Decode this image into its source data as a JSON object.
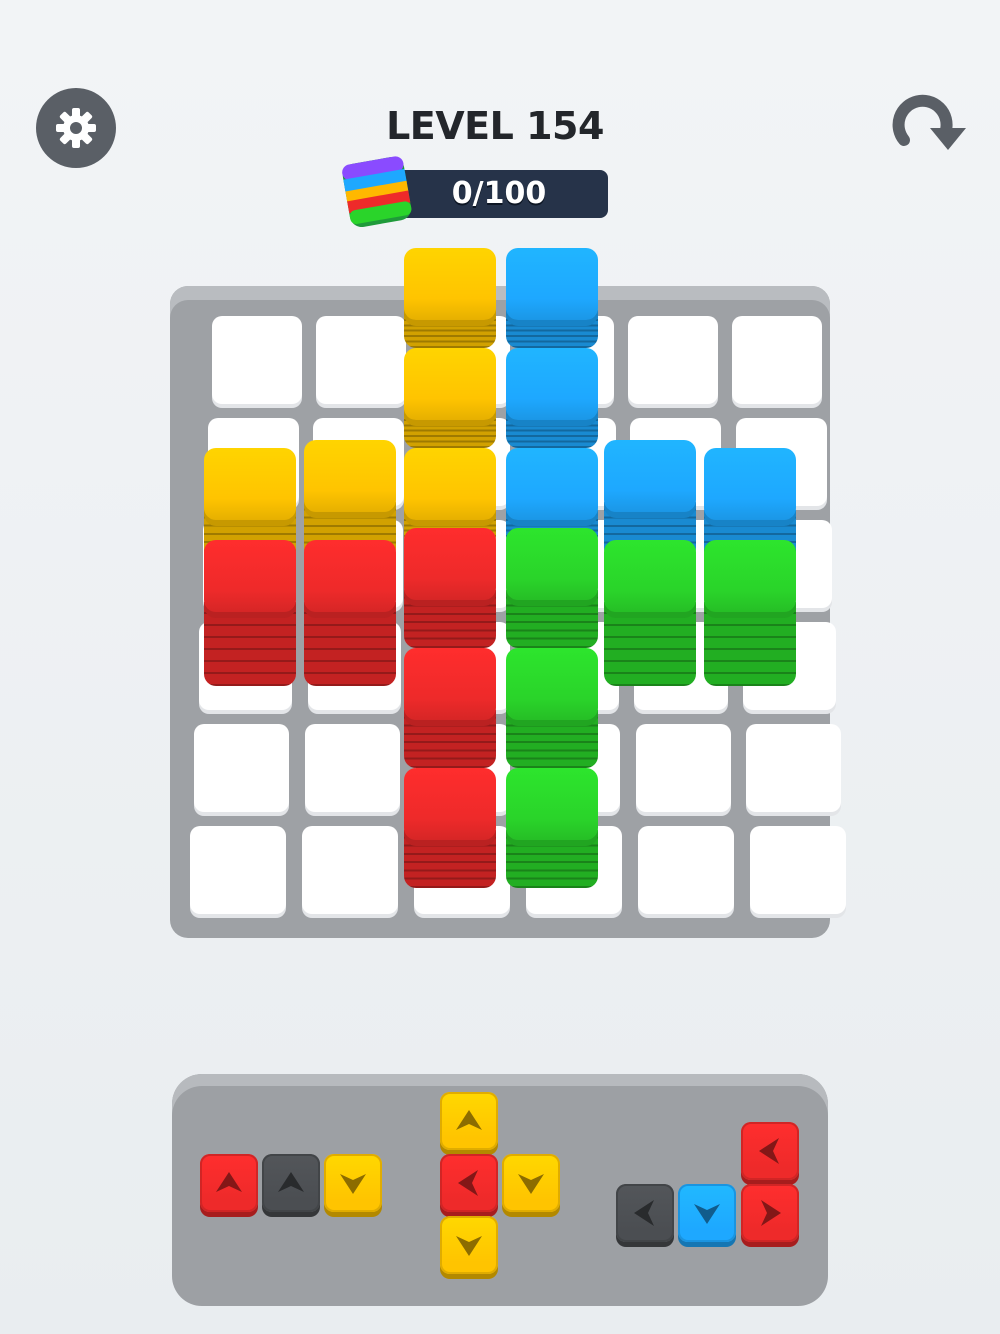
{
  "header": {
    "level_label": "LEVEL 154",
    "progress_text": "0/100",
    "progress_value": 0,
    "progress_max": 100
  },
  "icons": {
    "settings": "gear-icon",
    "restart": "restart-icon",
    "progress": "stacked-tiles-icon"
  },
  "colors": {
    "yellow": "#ffc400",
    "blue": "#1ea8ff",
    "red": "#ee2a2a",
    "green": "#2ad42a",
    "gray": "#4b4e52"
  },
  "board": {
    "rows": 6,
    "cols": 6,
    "stacks": [
      {
        "color": "yellow",
        "col": 0,
        "row": 2,
        "height": "low"
      },
      {
        "color": "yellow",
        "col": 1,
        "row": 2,
        "height": "low"
      },
      {
        "color": "yellow",
        "col": 2,
        "row": 0,
        "height": "tall"
      },
      {
        "color": "blue",
        "col": 3,
        "row": 0,
        "height": "tall"
      },
      {
        "color": "blue",
        "col": 4,
        "row": 2,
        "height": "low"
      },
      {
        "color": "blue",
        "col": 5,
        "row": 2,
        "height": "low"
      },
      {
        "color": "red",
        "col": 0,
        "row": 3,
        "height": "low"
      },
      {
        "color": "red",
        "col": 1,
        "row": 3,
        "height": "low"
      },
      {
        "color": "red",
        "col": 2,
        "row": 3,
        "height": "tall"
      },
      {
        "color": "green",
        "col": 3,
        "row": 3,
        "height": "tall"
      },
      {
        "color": "green",
        "col": 4,
        "row": 3,
        "height": "low"
      },
      {
        "color": "green",
        "col": 5,
        "row": 3,
        "height": "low"
      }
    ]
  },
  "controls": {
    "groups": [
      {
        "name": "group-1",
        "keys": [
          {
            "color": "red",
            "dir": "up"
          },
          {
            "color": "gray",
            "dir": "up"
          },
          {
            "color": "yellow",
            "dir": "down"
          }
        ]
      },
      {
        "name": "group-2",
        "keys": [
          {
            "color": "yellow",
            "dir": "up"
          },
          {
            "color": "red",
            "dir": "left"
          },
          {
            "color": "yellow",
            "dir": "down"
          },
          {
            "color": "yellow",
            "dir": "down"
          }
        ]
      },
      {
        "name": "group-3",
        "keys": [
          {
            "color": "red",
            "dir": "left"
          },
          {
            "color": "gray",
            "dir": "left"
          },
          {
            "color": "blue",
            "dir": "down"
          },
          {
            "color": "red",
            "dir": "right"
          }
        ]
      }
    ]
  }
}
